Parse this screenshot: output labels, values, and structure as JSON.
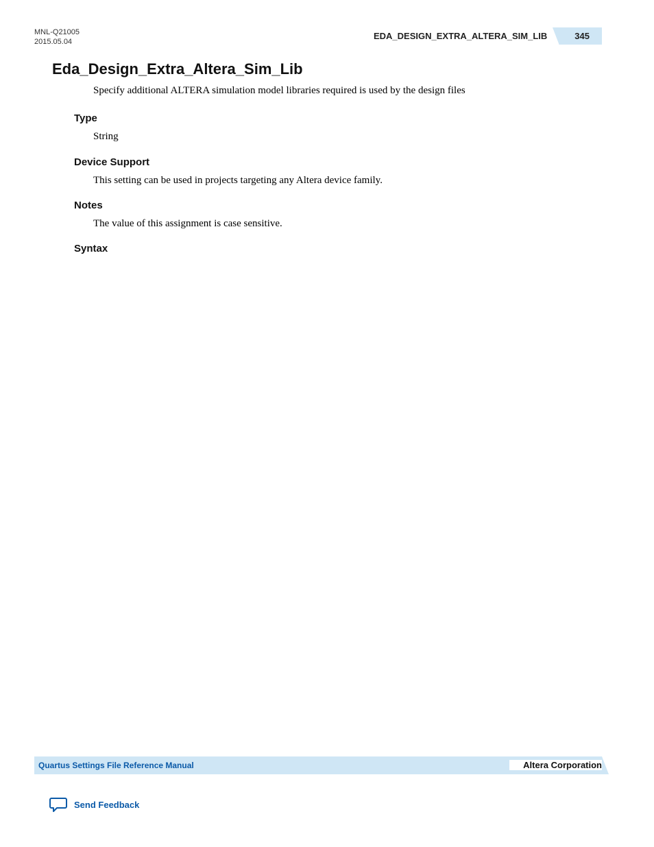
{
  "header": {
    "doc_id": "MNL-Q21005",
    "doc_date": "2015.05.04",
    "running_title": "EDA_DESIGN_EXTRA_ALTERA_SIM_LIB",
    "page_number": "345"
  },
  "main": {
    "heading": "Eda_Design_Extra_Altera_Sim_Lib",
    "intro": "Specify additional ALTERA simulation model libraries required is used by the design files",
    "sections": {
      "type_heading": "Type",
      "type_body": "String",
      "device_support_heading": "Device Support",
      "device_support_body": "This setting can be used in projects targeting any Altera device family.",
      "notes_heading": "Notes",
      "notes_body": "The value of this assignment is case sensitive.",
      "syntax_heading": "Syntax"
    }
  },
  "footer": {
    "ref_manual": "Quartus Settings File Reference Manual",
    "corporation": "Altera Corporation",
    "feedback_label": "Send Feedback"
  }
}
